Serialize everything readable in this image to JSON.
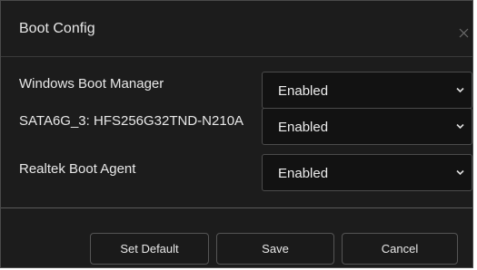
{
  "dialog": {
    "title": "Boot Config",
    "close_icon": "close-icon"
  },
  "boot_options": [
    {
      "label": "Windows Boot Manager",
      "value": "Enabled"
    },
    {
      "label": "SATA6G_3: HFS256G32TND-N210A",
      "value": "Enabled"
    },
    {
      "label": "Realtek Boot Agent",
      "value": "Enabled"
    }
  ],
  "footer": {
    "set_default_label": "Set Default",
    "save_label": "Save",
    "cancel_label": "Cancel"
  }
}
